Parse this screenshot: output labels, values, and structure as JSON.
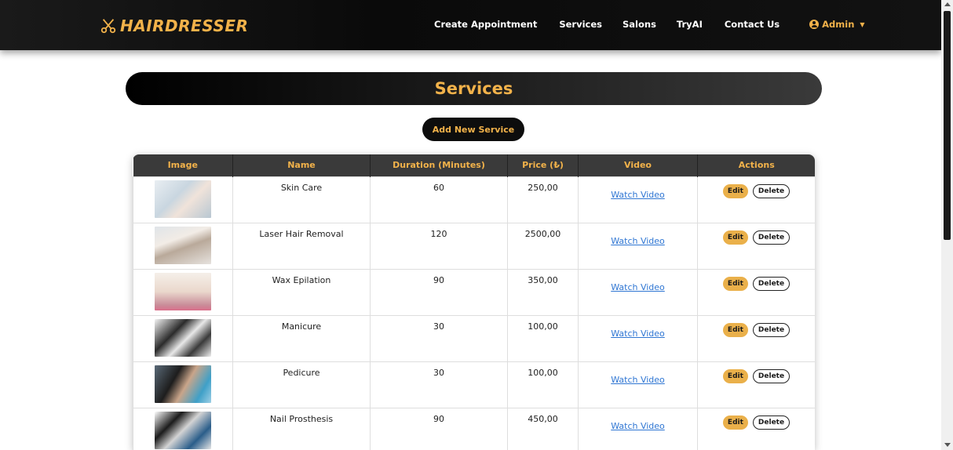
{
  "nav": {
    "brand": "HAIRDRESSER",
    "links": [
      "Create Appointment",
      "Services",
      "Salons",
      "TryAI",
      "Contact Us"
    ],
    "user_label": "Admin"
  },
  "page": {
    "title": "Services",
    "add_button": "Add New Service"
  },
  "table": {
    "headers": [
      "Image",
      "Name",
      "Duration (Minutes)",
      "Price (₺)",
      "Video",
      "Actions"
    ],
    "rows": [
      {
        "name": "Skin Care",
        "duration": "60",
        "price": "250,00",
        "video": "Watch Video",
        "edit": "Edit",
        "delete": "Delete"
      },
      {
        "name": "Laser Hair Removal",
        "duration": "120",
        "price": "2500,00",
        "video": "Watch Video",
        "edit": "Edit",
        "delete": "Delete"
      },
      {
        "name": "Wax Epilation",
        "duration": "90",
        "price": "350,00",
        "video": "Watch Video",
        "edit": "Edit",
        "delete": "Delete"
      },
      {
        "name": "Manicure",
        "duration": "30",
        "price": "100,00",
        "video": "Watch Video",
        "edit": "Edit",
        "delete": "Delete"
      },
      {
        "name": "Pedicure",
        "duration": "30",
        "price": "100,00",
        "video": "Watch Video",
        "edit": "Edit",
        "delete": "Delete"
      },
      {
        "name": "Nail Prosthesis",
        "duration": "90",
        "price": "450,00",
        "video": "Watch Video",
        "edit": "Edit",
        "delete": "Delete"
      }
    ]
  },
  "colors": {
    "accent": "#f2b24a",
    "navbar": "#0a0a0a",
    "link": "#2f76d3",
    "header_bg": "#3a3a3a"
  }
}
